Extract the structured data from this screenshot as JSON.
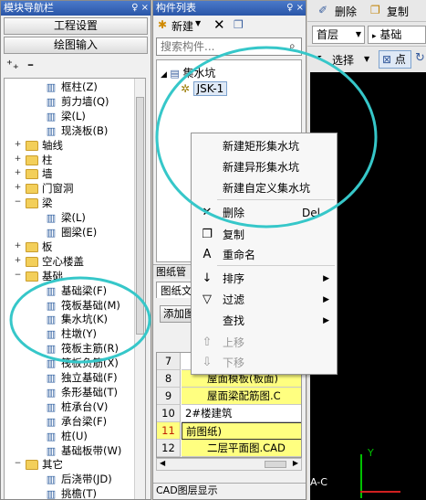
{
  "left_panel": {
    "title": "模块导航栏",
    "pin_label": "♀ ×",
    "btn_project": "工程设置",
    "btn_drawing": "绘图输入",
    "items": [
      {
        "label": "框柱(Z)",
        "type": "leaf"
      },
      {
        "label": "剪力墙(Q)",
        "type": "leaf"
      },
      {
        "label": "梁(L)",
        "type": "leaf"
      },
      {
        "label": "现浇板(B)",
        "type": "leaf"
      },
      {
        "label": "轴线",
        "type": "folder"
      },
      {
        "label": "柱",
        "type": "folder"
      },
      {
        "label": "墙",
        "type": "folder"
      },
      {
        "label": "门窗洞",
        "type": "folder"
      },
      {
        "label": "梁",
        "type": "folder-open"
      },
      {
        "label": "梁(L)",
        "type": "leaf"
      },
      {
        "label": "圈梁(E)",
        "type": "leaf"
      },
      {
        "label": "板",
        "type": "folder"
      },
      {
        "label": "空心楼盖",
        "type": "folder"
      },
      {
        "label": "基础",
        "type": "folder-open"
      },
      {
        "label": "基础梁(F)",
        "type": "leaf"
      },
      {
        "label": "筏板基础(M)",
        "type": "leaf"
      },
      {
        "label": "集水坑(K)",
        "type": "leaf"
      },
      {
        "label": "柱墩(Y)",
        "type": "leaf"
      },
      {
        "label": "筏板主筋(R)",
        "type": "leaf"
      },
      {
        "label": "筏板负筋(X)",
        "type": "leaf"
      },
      {
        "label": "独立基础(F)",
        "type": "leaf"
      },
      {
        "label": "条形基础(T)",
        "type": "leaf"
      },
      {
        "label": "桩承台(V)",
        "type": "leaf"
      },
      {
        "label": "承台梁(F)",
        "type": "leaf"
      },
      {
        "label": "桩(U)",
        "type": "leaf"
      },
      {
        "label": "基础板带(W)",
        "type": "leaf"
      },
      {
        "label": "其它",
        "type": "folder-open"
      },
      {
        "label": "后浇带(JD)",
        "type": "leaf"
      },
      {
        "label": "挑檐(T)",
        "type": "leaf"
      }
    ]
  },
  "mid_panel": {
    "title": "构件列表",
    "pin_label": "♀ ×",
    "new_label": "新建",
    "search_placeholder": "搜索构件...",
    "tree_root": "集水坑",
    "tree_child": "JSK-1",
    "drawing_title": "图纸管",
    "drawing_tab": "图纸文",
    "add_btn": "添加图",
    "rows": [
      {
        "num": "7",
        "text": ""
      },
      {
        "num": "8",
        "text": "屋面模板(板面)"
      },
      {
        "num": "9",
        "text": "屋面梁配筋图.C"
      },
      {
        "num": "10",
        "text": "2#楼建筑"
      },
      {
        "num": "11",
        "text": "前图纸)"
      },
      {
        "num": "12",
        "text": "二层平面图.CAD"
      }
    ],
    "cad_bottom": "CAD图层显示"
  },
  "right_panel": {
    "tool_delete": "删除",
    "tool_copy": "复制",
    "floor_value": "首层",
    "base_value": "基础",
    "tool_select": "选择",
    "tool_point": "点",
    "axis_label": "A-C"
  },
  "context_menu": {
    "items": [
      {
        "label": "新建矩形集水坑",
        "icon": "",
        "shortcut": "",
        "arrow": false,
        "disabled": false
      },
      {
        "label": "新建异形集水坑",
        "icon": "",
        "shortcut": "",
        "arrow": false,
        "disabled": false
      },
      {
        "label": "新建自定义集水坑",
        "icon": "",
        "shortcut": "",
        "arrow": false,
        "disabled": false
      },
      {
        "label": "删除",
        "icon": "✕",
        "shortcut": "Del",
        "arrow": false,
        "disabled": false
      },
      {
        "label": "复制",
        "icon": "❐",
        "shortcut": "",
        "arrow": false,
        "disabled": false
      },
      {
        "label": "重命名",
        "icon": "A",
        "shortcut": "",
        "arrow": false,
        "disabled": false
      },
      {
        "label": "排序",
        "icon": "↓",
        "shortcut": "",
        "arrow": true,
        "disabled": false
      },
      {
        "label": "过滤",
        "icon": "▽",
        "shortcut": "",
        "arrow": true,
        "disabled": false
      },
      {
        "label": "查找",
        "icon": "",
        "shortcut": "",
        "arrow": true,
        "disabled": false
      },
      {
        "label": "上移",
        "icon": "⇧",
        "shortcut": "",
        "arrow": false,
        "disabled": true
      },
      {
        "label": "下移",
        "icon": "⇩",
        "shortcut": "",
        "arrow": false,
        "disabled": true
      }
    ]
  },
  "colors": {
    "highlight_circle": "#36c7c9",
    "yellow_row": "#ffff80",
    "canvas_bg": "#000000"
  }
}
